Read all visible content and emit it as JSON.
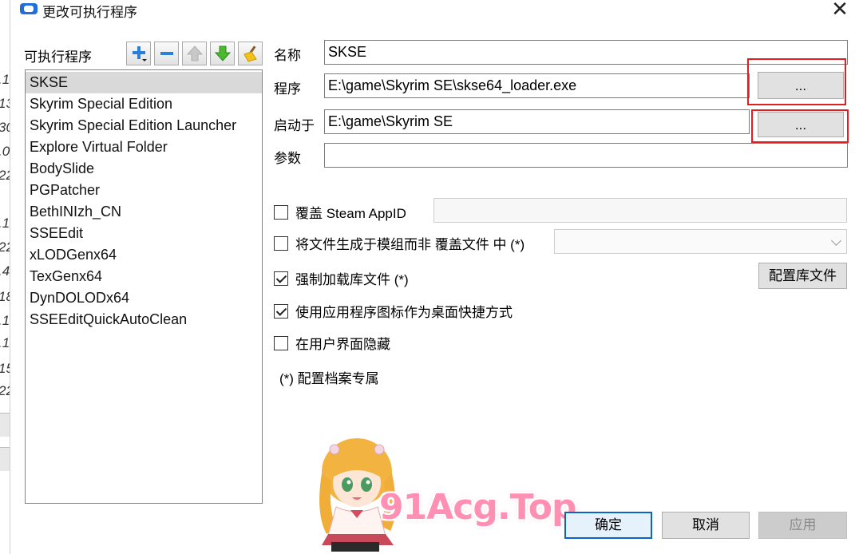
{
  "window": {
    "title": "更改可执行程序",
    "close_glyph": "✕"
  },
  "background": {
    "line_fragments": [
      ".1",
      "13",
      "30",
      ".0",
      "22",
      ".1",
      "22",
      ".4",
      "18",
      ".1",
      ".1",
      "15",
      "22"
    ]
  },
  "left_panel": {
    "label": "可执行程序",
    "toolbar_icons": [
      "add-icon",
      "remove-icon",
      "move-up-icon",
      "move-down-icon",
      "clean-icon"
    ],
    "items": [
      "SKSE",
      "Skyrim Special Edition",
      "Skyrim Special Edition Launcher",
      "Explore Virtual Folder",
      "BodySlide",
      "PGPatcher",
      "BethINIzh_CN",
      "SSEEdit",
      "xLODGenx64",
      "TexGenx64",
      "DynDOLODx64",
      "SSEEditQuickAutoClean"
    ],
    "selected_index": 0
  },
  "form": {
    "name_label": "名称",
    "name_value": "SKSE",
    "program_label": "程序",
    "program_value": "E:\\game\\Skyrim SE\\skse64_loader.exe",
    "browse_label": "...",
    "start_in_label": "启动于",
    "start_in_value": "E:\\game\\Skyrim SE",
    "args_label": "参数",
    "args_value": ""
  },
  "options": {
    "override_steam_label": "覆盖 Steam AppID",
    "override_steam_checked": false,
    "override_steam_value": "",
    "create_files_label": "将文件生成于模组而非 覆盖文件 中 (*)",
    "create_files_checked": false,
    "create_files_value": "",
    "force_load_label": "强制加载库文件 (*)",
    "force_load_checked": true,
    "configure_libs_label": "配置库文件",
    "use_icon_label": "使用应用程序图标作为桌面快捷方式",
    "use_icon_checked": true,
    "hide_ui_label": "在用户界面隐藏",
    "hide_ui_checked": false,
    "profile_note": "(*) 配置档案专属"
  },
  "footer": {
    "ok_label": "确定",
    "cancel_label": "取消",
    "apply_label": "应用"
  },
  "watermark": {
    "text": "91Acg.Top"
  },
  "colors": {
    "accent_blue": "#0a64c8",
    "highlight_red": "#e02020",
    "selection_gray": "#d9d9d9",
    "watermark_pink": "#ff8fb3"
  }
}
